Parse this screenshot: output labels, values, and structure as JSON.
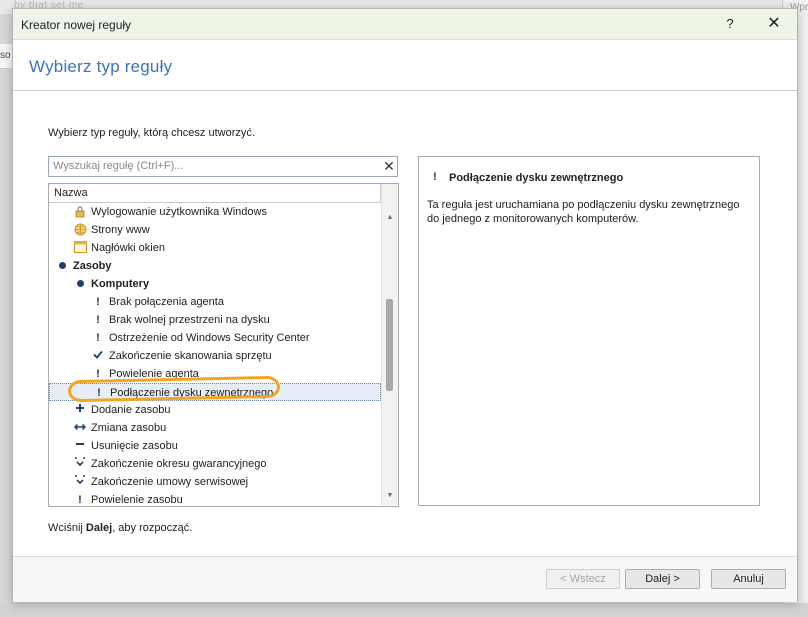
{
  "background": {
    "top_fragment": "by that set me",
    "right_fragment": "Wpro",
    "left_fragment": "so"
  },
  "window": {
    "title": "Kreator nowej reguły",
    "help_label": "?",
    "close_label": "✕"
  },
  "header": {
    "title": "Wybierz typ reguły"
  },
  "instruction": "Wybierz typ reguły, którą chcesz utworzyć.",
  "search": {
    "placeholder": "Wyszukaj regułę (Ctrl+F)...",
    "value": "",
    "clear_label": "✕"
  },
  "list": {
    "column_header": "Nazwa",
    "items": [
      {
        "label": "Wylogowanie użytkownika Windows",
        "icon": "lock-icon"
      },
      {
        "label": "Strony www",
        "icon": "globe-icon"
      },
      {
        "label": "Nagłówki okien",
        "icon": "window-icon"
      },
      {
        "label": "Zasoby",
        "icon": "bullet-icon"
      },
      {
        "label": "Komputery",
        "icon": "bullet-icon"
      },
      {
        "label": "Brak połączenia agenta",
        "icon": "exclamation-icon"
      },
      {
        "label": "Brak wolnej przestrzeni na dysku",
        "icon": "exclamation-icon"
      },
      {
        "label": "Ostrzeżenie od Windows Security Center",
        "icon": "exclamation-icon"
      },
      {
        "label": "Zakończenie skanowania sprzętu",
        "icon": "check-icon"
      },
      {
        "label": "Powielenie agenta",
        "icon": "exclamation-icon"
      },
      {
        "label": "Podłączenie dysku zewnętrznego",
        "icon": "exclamation-icon"
      },
      {
        "label": "Dodanie zasobu",
        "icon": "plus-icon"
      },
      {
        "label": "Zmiana zasobu",
        "icon": "arrows-icon"
      },
      {
        "label": "Usunięcie zasobu",
        "icon": "minus-icon"
      },
      {
        "label": "Zakończenie okresu gwarancyjnego",
        "icon": "expiry-icon"
      },
      {
        "label": "Zakończenie umowy serwisowej",
        "icon": "expiry-icon"
      },
      {
        "label": "Powielenie zasobu",
        "icon": "exclamation-icon"
      }
    ],
    "selected_index": 10
  },
  "description": {
    "title": "Podłączenie dysku zewnętrznego",
    "text": "Ta reguła jest uruchamiana po podłączeniu dysku zewnętrznego do jednego z monitorowanych komputerów."
  },
  "footer": {
    "hint_prefix": "Wciśnij ",
    "hint_bold": "Dalej",
    "hint_suffix": ", aby rozpocząć."
  },
  "buttons": {
    "back": "< Wstecz",
    "next": "Dalej >",
    "cancel": "Anuluj"
  }
}
